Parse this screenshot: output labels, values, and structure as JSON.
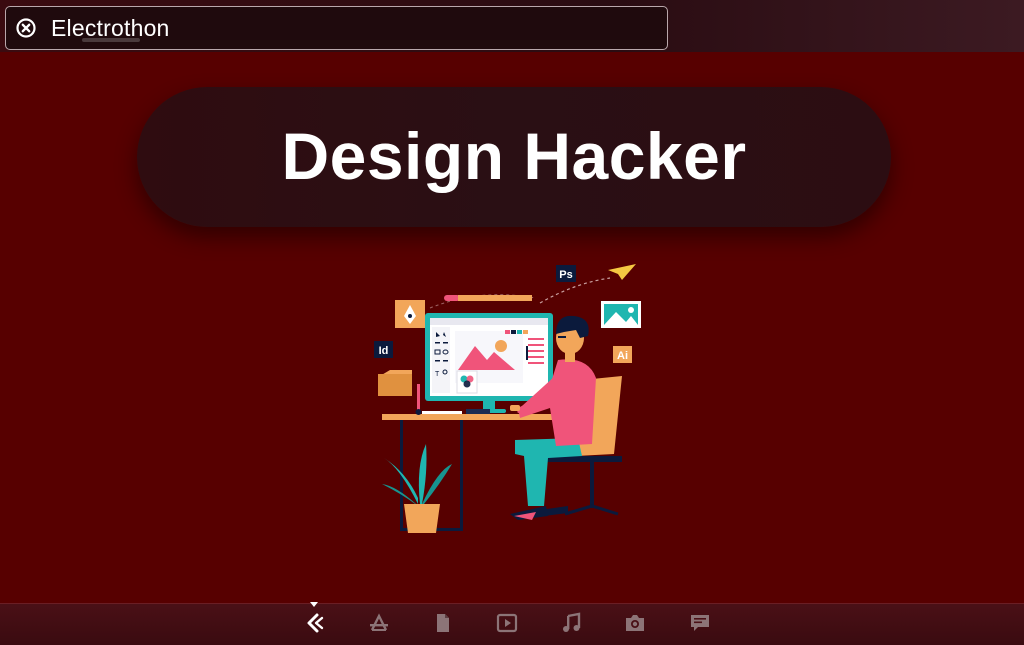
{
  "search": {
    "value": "Electrothon"
  },
  "banner": {
    "title": "Design Hacker"
  },
  "illustration": {
    "badges": [
      "Ps",
      "Id",
      "Ai"
    ]
  },
  "dock": {
    "items": [
      {
        "icon": "app-logo-icon",
        "active": true
      },
      {
        "icon": "apps-icon",
        "active": false
      },
      {
        "icon": "document-icon",
        "active": false
      },
      {
        "icon": "video-icon",
        "active": false
      },
      {
        "icon": "music-icon",
        "active": false
      },
      {
        "icon": "camera-icon",
        "active": false
      },
      {
        "icon": "message-icon",
        "active": false
      }
    ]
  },
  "colors": {
    "background": "#570000",
    "pill": "#2d0d11",
    "accent_pink": "#f0547a",
    "accent_teal": "#1fb6b0",
    "accent_orange": "#f2a65a"
  }
}
